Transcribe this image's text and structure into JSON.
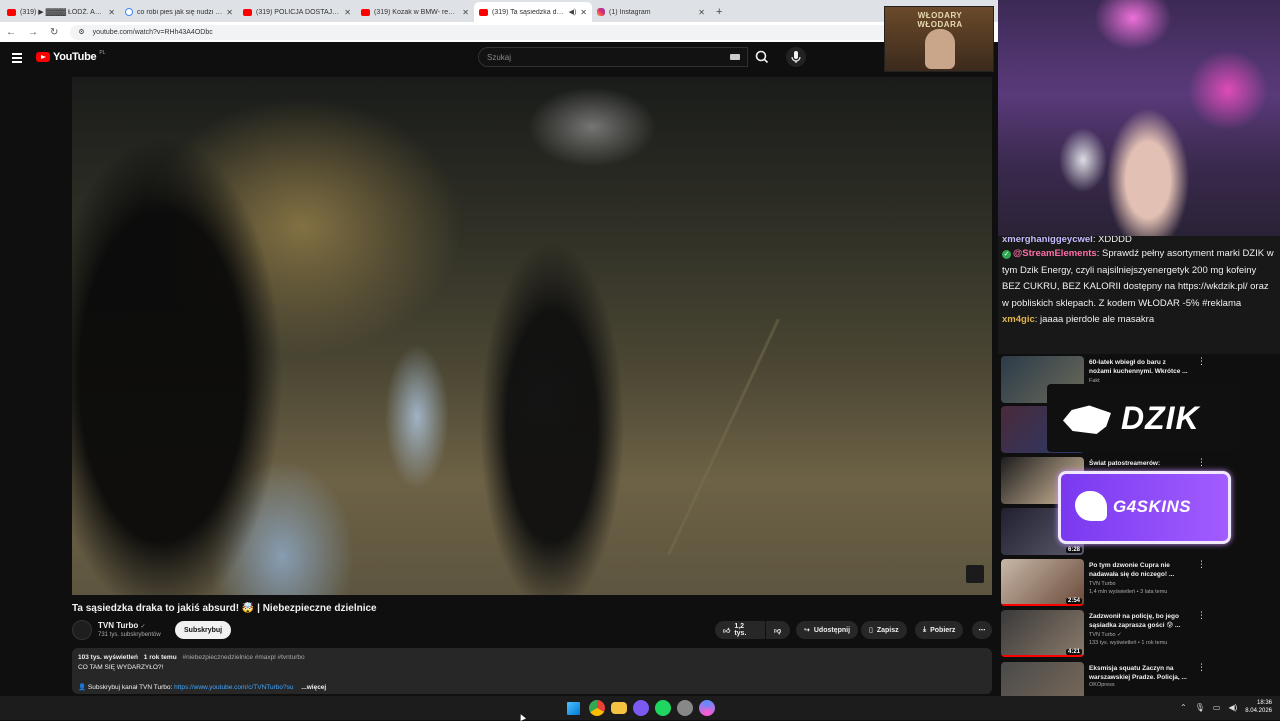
{
  "browser": {
    "tabs": [
      {
        "label": "(319) ▶ ▓▓▓▓ ŁÓDŹ. Ankie",
        "favicon": "youtube-icon",
        "active": false
      },
      {
        "label": "co robi pies jak się nudzi - Szuk",
        "favicon": "google-icon",
        "active": false
      },
      {
        "label": "(319) POLICJA DOSTAJE WPIER",
        "favicon": "youtube-icon",
        "active": false
      },
      {
        "label": "(319) Kozak w BMW- reupload",
        "favicon": "youtube-icon",
        "active": false
      },
      {
        "label": "(319) Ta sąsiedzka draka to",
        "favicon": "youtube-icon",
        "active": true
      },
      {
        "label": "(1) Instagram",
        "favicon": "instagram-icon",
        "active": false
      }
    ],
    "new_tab": "+",
    "url": "youtube.com/watch?v=RHh43A4ODbc"
  },
  "youtube": {
    "logo": "YouTube",
    "region": "PL",
    "search_placeholder": "Szukaj"
  },
  "video": {
    "title": "Ta sąsiedzka draka to jakiś absurd! 🤯 | Niebezpieczne dzielnice",
    "channel": {
      "name": "TVN Turbo",
      "verified": "✓",
      "subscribers": "731 tys. subskrybentów"
    },
    "subscribe_label": "Subskrybuj",
    "like_count": "1,2 tys.",
    "share_label": "Udostępnij",
    "save_label": "Zapisz",
    "download_label": "Pobierz",
    "more_label": "⋯",
    "description": {
      "views": "103 tys. wyświetleń",
      "age": "1 rok temu",
      "tags": "#niebezpiecznedzielnice #maxpl #tvnturbo",
      "line1": "CO TAM SIĘ WYDARZYŁO?!",
      "line2_prefix": "👤 Subskrybuj kanał TVN Turbo:",
      "line2_link": "https://www.youtube.com/c/TVNTurbo?su",
      "more": "...więcej"
    }
  },
  "stream": {
    "badge_text_1": "WŁODARY",
    "badge_text_2": "WŁODARA",
    "chat": [
      {
        "user": "xmerghaniggeycwel",
        "text": "XDDDD"
      },
      {
        "user": "@StreamElements",
        "text": "Sprawdź pełny asortyment marki DZIK w tym Dzik Energy, czyli najsilniejszyenergetyk 200 mg kofeiny BEZ CUKRU, BEZ KALORII dostępny na https://wkdzik.pl/ oraz w pobliskich sklepach. Z kodem WŁODAR -5% #reklama"
      },
      {
        "user": "xm4gic",
        "text": "jaaaa pierdole ale masakra"
      }
    ],
    "sponsor_1": "DZIK",
    "sponsor_2": "G4SKINS"
  },
  "recommended": [
    {
      "title": "60-latek wbiegł do baru z nożami kuchennymi. Wkrótce ...",
      "channel": "Fakt",
      "meta": "",
      "duration": ""
    },
    {
      "title": "",
      "channel": "",
      "meta": "",
      "duration": ""
    },
    {
      "title": "Świat patostreamerów:",
      "channel": "",
      "meta": "",
      "duration": ""
    },
    {
      "title": "",
      "channel": "",
      "meta": "",
      "duration": "6:28"
    },
    {
      "title": "Po tym dzwonie Cupra nie nadawała się do niczego! ...",
      "channel": "TVN Turbo",
      "meta": "1,4 mln wyświetleń • 3 lata temu",
      "duration": "2:54"
    },
    {
      "title": "Zadzwonił na policję, bo jego sąsiadka zaprasza gości 😰 ...",
      "channel": "TVN Turbo ✓",
      "meta": "133 tys. wyświetleń • 1 rok temu",
      "duration": "4:21"
    },
    {
      "title": "Eksmisja squatu Zaczyn na warszawskiej Pradze. Policja, ...",
      "channel": "OKOpress",
      "meta": "",
      "duration": ""
    }
  ],
  "taskbar": {
    "time": "18:36",
    "date": "8.04.2026"
  },
  "colors": {
    "yt_red": "#ff0000",
    "link_blue": "#3ea6ff",
    "g4_purple": "#8a45f5"
  }
}
